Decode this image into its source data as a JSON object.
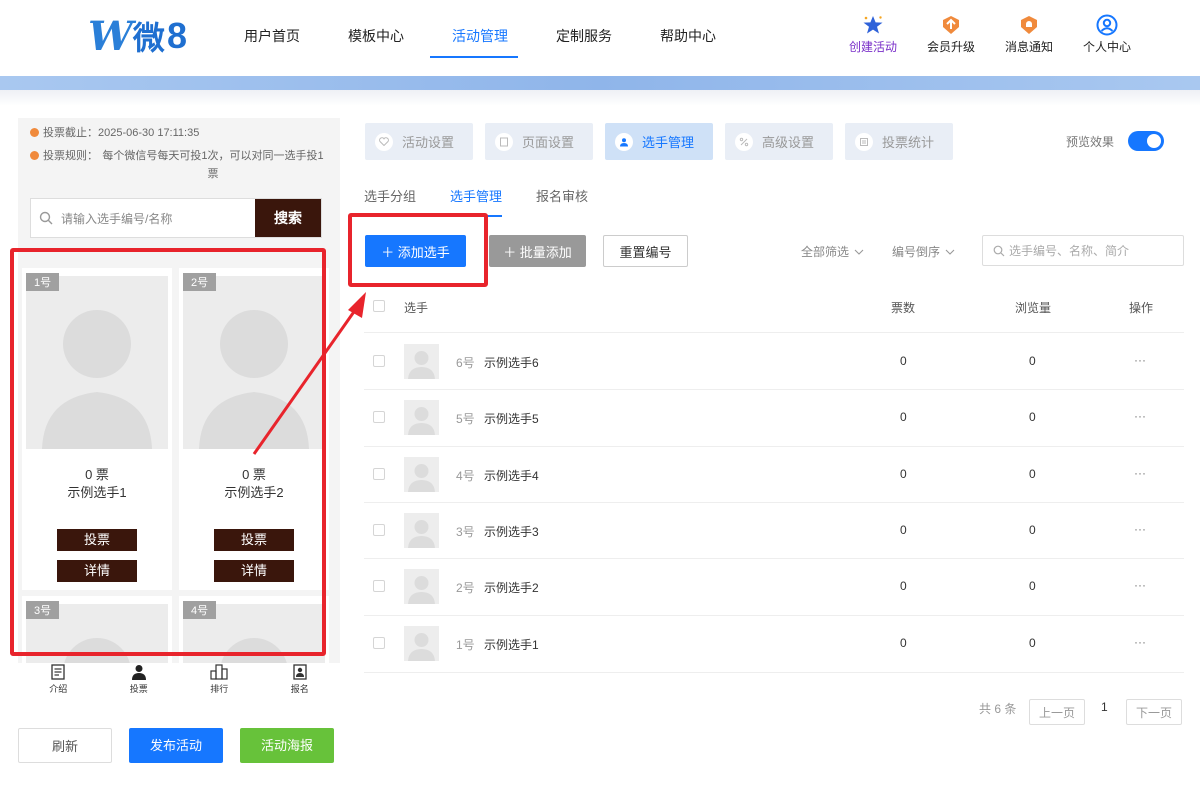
{
  "header": {
    "logo": {
      "w": "W",
      "wei": "微",
      "eight": "8"
    },
    "nav": [
      {
        "label": "用户首页"
      },
      {
        "label": "模板中心"
      },
      {
        "label": "活动管理",
        "active": true
      },
      {
        "label": "定制服务"
      },
      {
        "label": "帮助中心"
      }
    ],
    "actions": {
      "create": "创建活动",
      "upgrade": "会员升级",
      "notify": "消息通知",
      "profile": "个人中心"
    }
  },
  "preview_panel": {
    "deadline_label": "投票截止：",
    "deadline_value": "2025-06-30 17:11:35",
    "rule_label": "投票规则：",
    "rule_value": "每个微信号每天可投1次，可以对同一选手投1票",
    "search_placeholder": "请输入选手编号/名称",
    "search_button": "搜索",
    "cards": [
      {
        "tag": "1号",
        "votes": "0 票",
        "name": "示例选手1",
        "vote_btn": "投票",
        "detail_btn": "详情"
      },
      {
        "tag": "2号",
        "votes": "0 票",
        "name": "示例选手2",
        "vote_btn": "投票",
        "detail_btn": "详情"
      },
      {
        "tag": "3号"
      },
      {
        "tag": "4号"
      }
    ],
    "bottom_nav": [
      {
        "label": "介绍",
        "icon": "intro-icon"
      },
      {
        "label": "投票",
        "icon": "user-icon"
      },
      {
        "label": "排行",
        "icon": "ranking-icon"
      },
      {
        "label": "报名",
        "icon": "signup-icon"
      }
    ],
    "buttons": {
      "refresh": "刷新",
      "publish": "发布活动",
      "poster": "活动海报"
    }
  },
  "main": {
    "tabs": [
      {
        "label": "活动设置",
        "icon": "heart-icon"
      },
      {
        "label": "页面设置",
        "icon": "page-icon"
      },
      {
        "label": "选手管理",
        "icon": "user-icon",
        "active": true
      },
      {
        "label": "高级设置",
        "icon": "percent-icon"
      },
      {
        "label": "投票统计",
        "icon": "stats-icon"
      }
    ],
    "preview_label": "预览效果",
    "preview_on": true,
    "subtabs": [
      {
        "label": "选手分组"
      },
      {
        "label": "选手管理",
        "active": true
      },
      {
        "label": "报名审核"
      }
    ],
    "toolbar": {
      "add": "＋ 添加选手",
      "batch": "＋ 批量添加",
      "renumber": "重置编号",
      "filter": "全部筛选",
      "sort": "编号倒序",
      "search_placeholder": "选手编号、名称、简介"
    },
    "table": {
      "headers": {
        "player": "选手",
        "votes": "票数",
        "views": "浏览量",
        "ops": "操作"
      },
      "rows": [
        {
          "num": "6号",
          "name": "示例选手6",
          "votes": "0",
          "views": "0",
          "ops": "···"
        },
        {
          "num": "5号",
          "name": "示例选手5",
          "votes": "0",
          "views": "0",
          "ops": "···"
        },
        {
          "num": "4号",
          "name": "示例选手4",
          "votes": "0",
          "views": "0",
          "ops": "···"
        },
        {
          "num": "3号",
          "name": "示例选手3",
          "votes": "0",
          "views": "0",
          "ops": "···"
        },
        {
          "num": "2号",
          "name": "示例选手2",
          "votes": "0",
          "views": "0",
          "ops": "···"
        },
        {
          "num": "1号",
          "name": "示例选手1",
          "votes": "0",
          "views": "0",
          "ops": "···"
        }
      ]
    },
    "pagination": {
      "total": "共 6 条",
      "prev": "上一页",
      "page": "1",
      "next": "下一页"
    }
  },
  "colors": {
    "accent": "#1677ff",
    "dark_brown": "#3a160c",
    "annotation_red": "#e8242c",
    "green": "#67c23a"
  }
}
